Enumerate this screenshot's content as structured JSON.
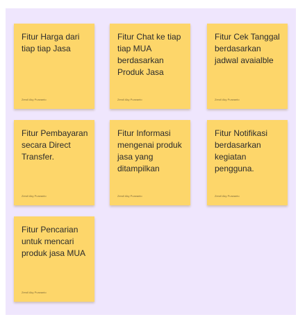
{
  "sticky_notes": [
    {
      "text": "Fitur Harga dari tiap tiap Jasa",
      "author": "Zeroll Aky Purwanto"
    },
    {
      "text": "Fitur Chat ke tiap tiap MUA berdasarkan Produk Jasa",
      "author": "Zeroll Aky Purwanto"
    },
    {
      "text": "Fitur Cek Tanggal berdasarkan jadwal avaialble",
      "author": "Zeroll Aky Purwanto"
    },
    {
      "text": "Fitur Pembayaran secara Direct Transfer.",
      "author": "Zeroll Aky Purwanto"
    },
    {
      "text": "Fitur Informasi mengenai produk jasa yang ditampilkan",
      "author": "Zeroll Aky Purwanto"
    },
    {
      "text": "Fitur Notifikasi berdasarkan kegiatan pengguna.",
      "author": "Zeroll Aky Purwanto"
    },
    {
      "text": "Fitur Pencarian untuk mencari produk jasa MUA",
      "author": "Zeroll Aky Purwanto"
    }
  ],
  "colors": {
    "board_background": "#efe6fd",
    "note_background": "#fdd66a"
  }
}
